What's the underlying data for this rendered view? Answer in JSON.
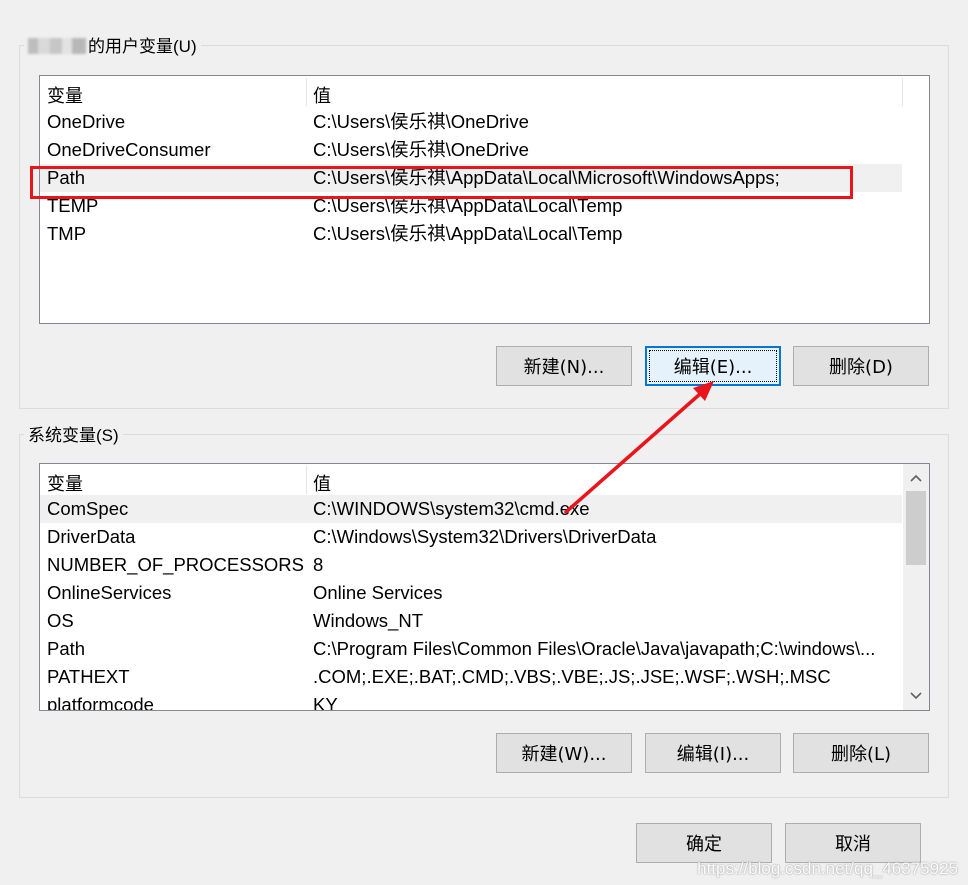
{
  "user_group": {
    "title": "的用户变量(U)",
    "col_variable": "变量",
    "col_value": "值",
    "rows": [
      {
        "name": "OneDrive",
        "value": "C:\\Users\\侯乐祺\\OneDrive"
      },
      {
        "name": "OneDriveConsumer",
        "value": "C:\\Users\\侯乐祺\\OneDrive"
      },
      {
        "name": "Path",
        "value": "C:\\Users\\侯乐祺\\AppData\\Local\\Microsoft\\WindowsApps;"
      },
      {
        "name": "TEMP",
        "value": "C:\\Users\\侯乐祺\\AppData\\Local\\Temp"
      },
      {
        "name": "TMP",
        "value": "C:\\Users\\侯乐祺\\AppData\\Local\\Temp"
      }
    ],
    "btn_new": "新建(N)...",
    "btn_edit": "编辑(E)...",
    "btn_delete": "删除(D)"
  },
  "system_group": {
    "title": "系统变量(S)",
    "col_variable": "变量",
    "col_value": "值",
    "rows": [
      {
        "name": "ComSpec",
        "value": "C:\\WINDOWS\\system32\\cmd.exe"
      },
      {
        "name": "DriverData",
        "value": "C:\\Windows\\System32\\Drivers\\DriverData"
      },
      {
        "name": "NUMBER_OF_PROCESSORS",
        "value": "8"
      },
      {
        "name": "OnlineServices",
        "value": "Online Services"
      },
      {
        "name": "OS",
        "value": "Windows_NT"
      },
      {
        "name": "Path",
        "value": "C:\\Program Files\\Common Files\\Oracle\\Java\\javapath;C:\\windows\\..."
      },
      {
        "name": "PATHEXT",
        "value": ".COM;.EXE;.BAT;.CMD;.VBS;.VBE;.JS;.JSE;.WSF;.WSH;.MSC"
      },
      {
        "name": "platformcode",
        "value": "KY"
      }
    ],
    "btn_new": "新建(W)...",
    "btn_edit": "编辑(I)...",
    "btn_delete": "删除(L)"
  },
  "footer": {
    "btn_ok": "确定",
    "btn_cancel": "取消"
  },
  "watermark": "https://blog.csdn.net/qq_46375925",
  "colors": {
    "annotation": "#e8161c",
    "focus": "#0078d7"
  }
}
